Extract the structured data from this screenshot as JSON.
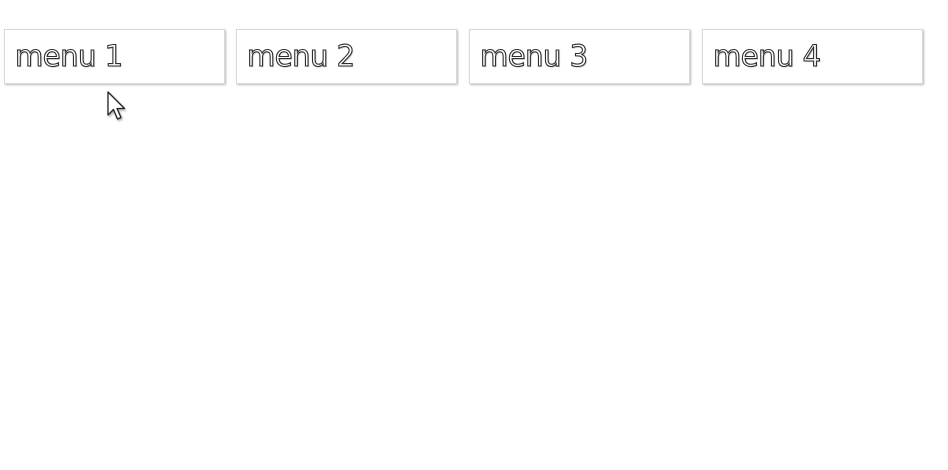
{
  "menu": {
    "items": [
      {
        "label": "menu 1"
      },
      {
        "label": "menu 2"
      },
      {
        "label": "menu 3"
      },
      {
        "label": "menu 4"
      }
    ]
  },
  "icons": {
    "cursor": "mouse-pointer-icon"
  },
  "colors": {
    "background": "#ffffff",
    "menu_border": "#d9d9d9",
    "text_outline": "#2f2f2f"
  }
}
